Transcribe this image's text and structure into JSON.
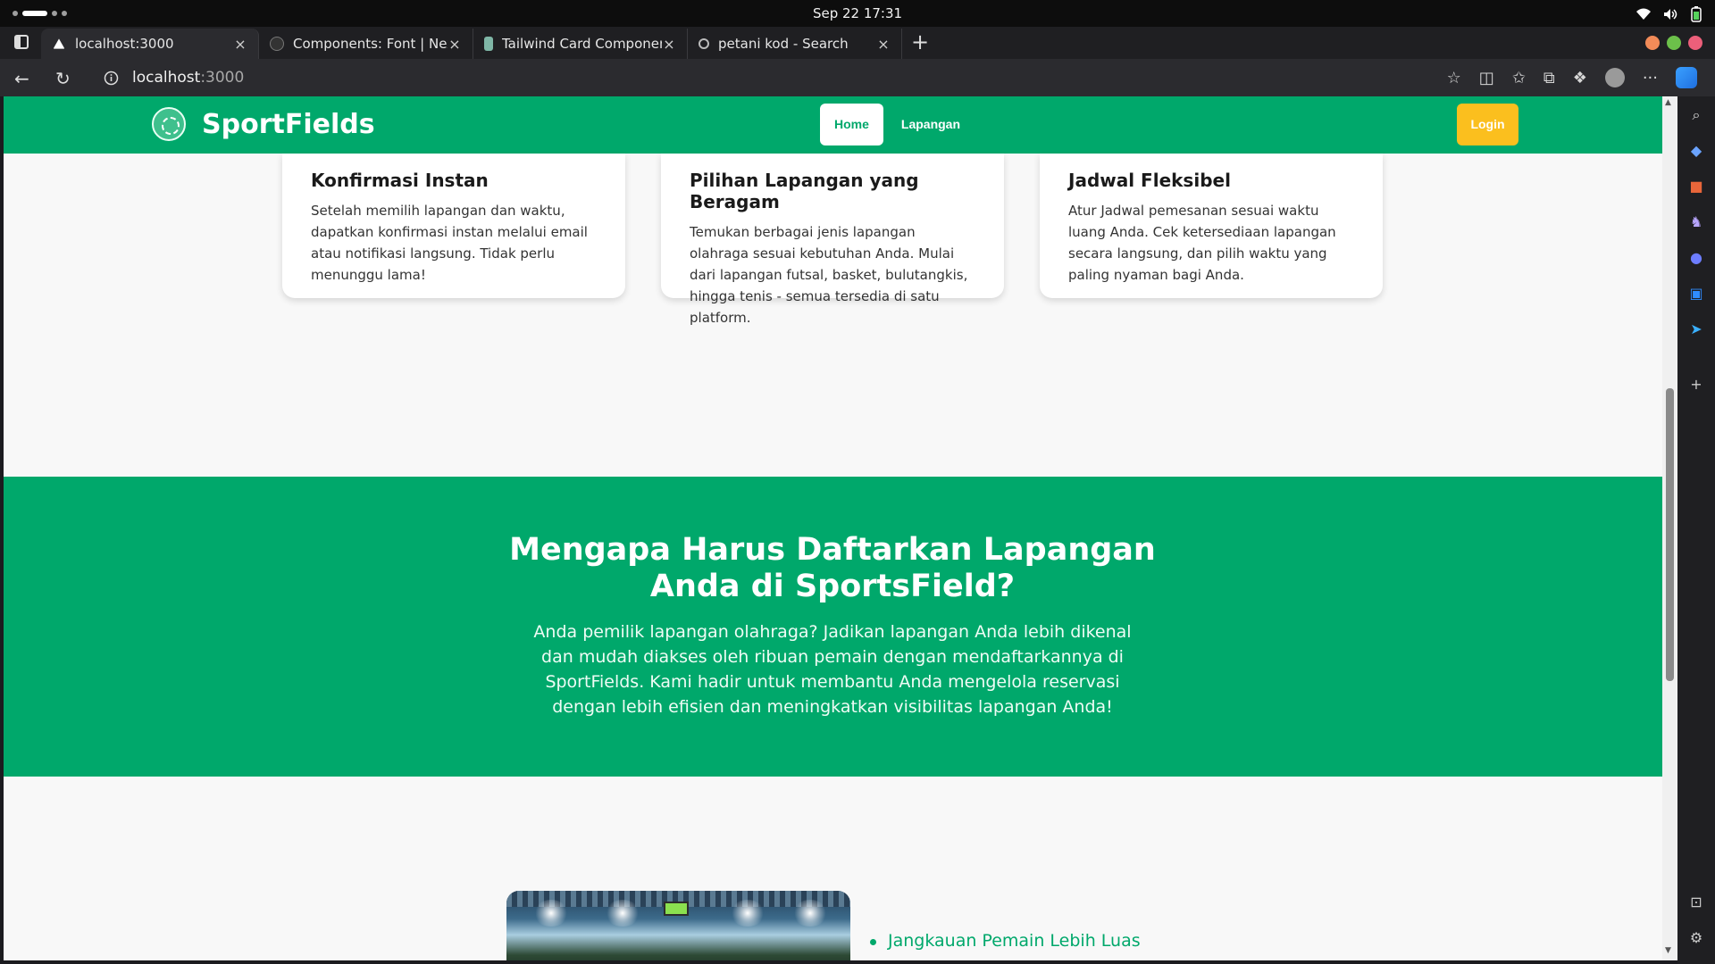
{
  "os": {
    "clock": "Sep 22  17:31"
  },
  "browser": {
    "tabs": [
      {
        "title": "localhost:3000",
        "active": true
      },
      {
        "title": "Components: Font | Next.j",
        "active": false
      },
      {
        "title": "Tailwind Card Component",
        "active": false
      },
      {
        "title": "petani kod - Search",
        "active": false
      }
    ],
    "new_tab": "+",
    "url_host": "localhost",
    "url_port": ":3000",
    "more": "···"
  },
  "site": {
    "brand": "SportFields",
    "nav": [
      {
        "label": "Home",
        "active": true
      },
      {
        "label": "Lapangan",
        "active": false
      }
    ],
    "login": "Login",
    "cards": [
      {
        "title": "Konfirmasi Instan",
        "body": "Setelah memilih lapangan dan waktu, dapatkan konfirmasi instan melalui email atau notifikasi langsung. Tidak perlu menunggu lama!"
      },
      {
        "title": "Pilihan Lapangan yang Beragam",
        "body": "Temukan berbagai jenis lapangan olahraga sesuai kebutuhan Anda. Mulai dari lapangan futsal, basket, bulutangkis, hingga tenis - semua tersedia di satu platform."
      },
      {
        "title": "Jadwal Fleksibel",
        "body": "Atur Jadwal pemesanan sesuai waktu luang Anda. Cek ketersediaan lapangan secara langsung, dan pilih waktu yang paling nyaman bagi Anda."
      }
    ],
    "why": {
      "title": "Mengapa Harus Daftarkan Lapangan Anda di SportsField?",
      "body": "Anda pemilik lapangan olahraga? Jadikan lapangan Anda lebih dikenal dan mudah diakses oleh ribuan pemain dengan mendaftarkannya di SportFields. Kami hadir untuk membantu Anda mengelola reservasi dengan lebih efisien dan meningkatkan visibilitas lapangan Anda!"
    },
    "benefits": [
      "Jangkauan Pemain Lebih Luas"
    ]
  },
  "colors": {
    "brand_green": "#00a86b",
    "login_yellow": "#fbbf1e"
  }
}
